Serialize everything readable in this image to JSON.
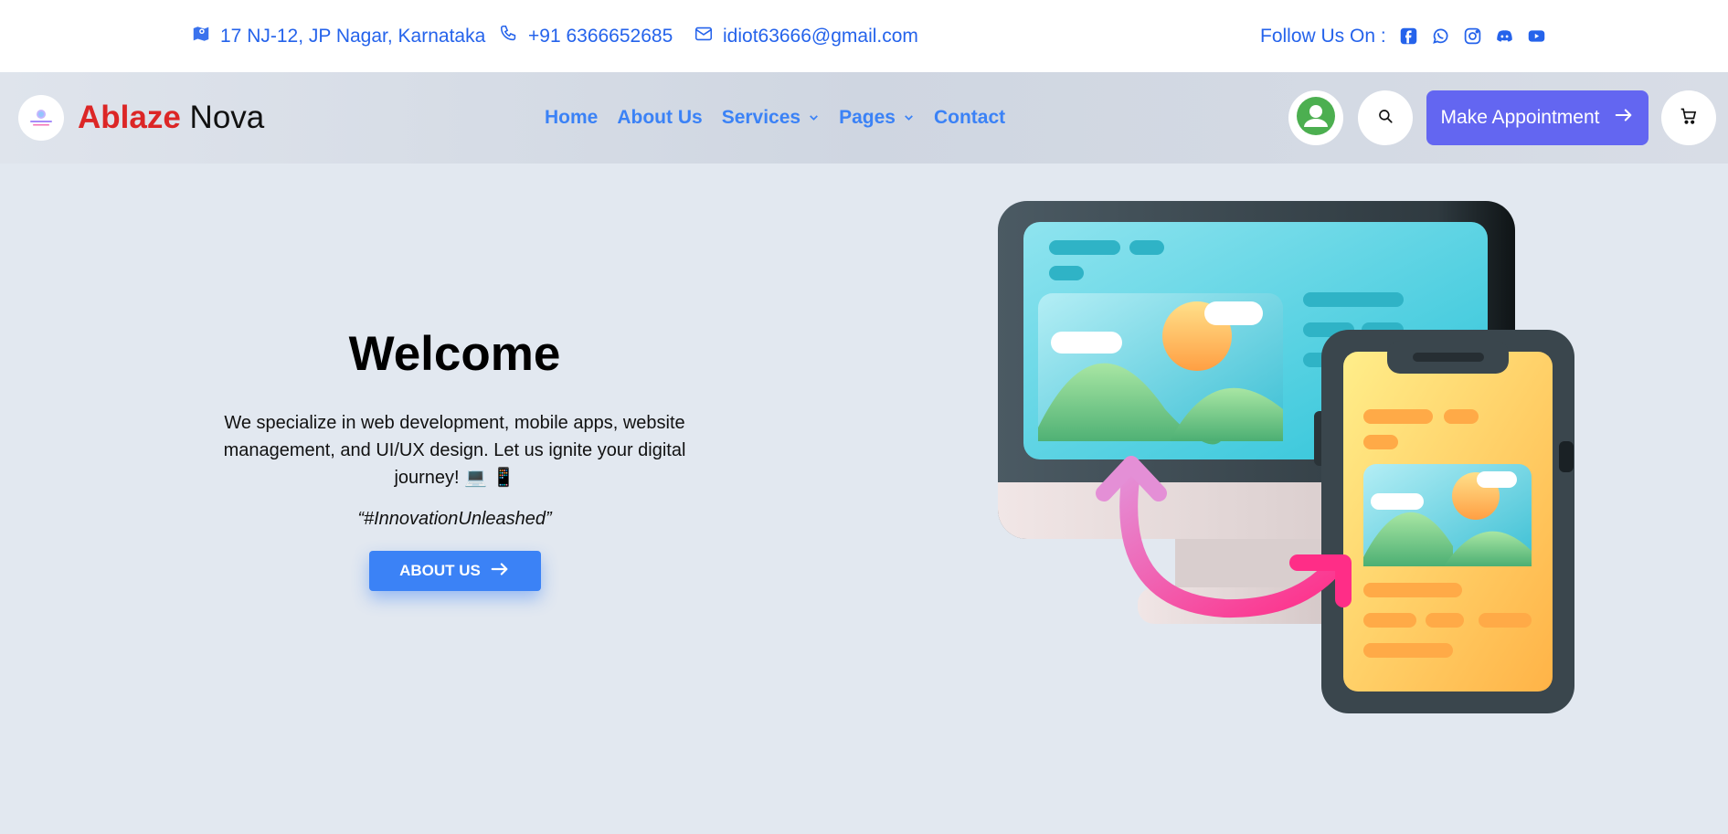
{
  "topbar": {
    "address": "17 NJ-12, JP Nagar, Karnataka",
    "phone": "+91 6366652685",
    "email": "idiot63666@gmail.com",
    "follow_label": "Follow Us On :",
    "social_icons": [
      "facebook-icon",
      "whatsapp-icon",
      "instagram-icon",
      "discord-icon",
      "youtube-icon"
    ]
  },
  "navbar": {
    "brand_first": "Ablaze",
    "brand_second": "Nova",
    "links": [
      "Home",
      "About Us",
      "Services",
      "Pages",
      "Contact"
    ],
    "appointment_label": "Make Appointment"
  },
  "hero": {
    "title": "Welcome",
    "description": "We specialize in web development, mobile apps, website management, and UI/UX design. Let us ignite your digital journey! 💻 📱",
    "tagline": "“#InnovationUnleashed”",
    "button_label": "ABOUT US"
  },
  "colors": {
    "accent_blue": "#3b82f6",
    "link_blue": "#2563eb",
    "brand_red": "#dc2626",
    "appointment_indigo": "#6366f1",
    "page_bg": "#e2e8f0"
  }
}
